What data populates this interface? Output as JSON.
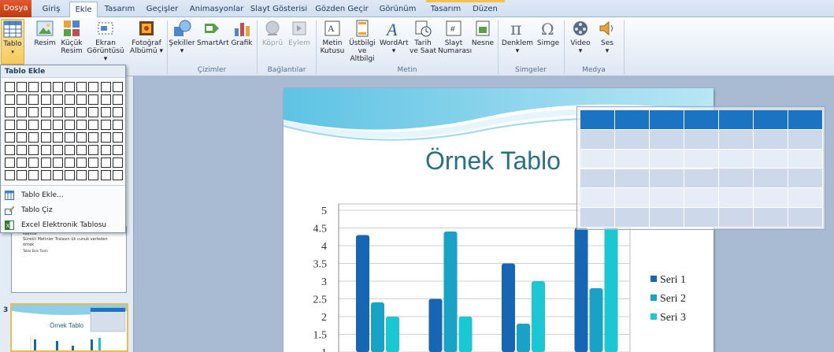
{
  "tabs": [
    {
      "label": "Dosya"
    },
    {
      "label": "Giriş"
    },
    {
      "label": "Ekle"
    },
    {
      "label": "Tasarım"
    },
    {
      "label": "Geçişler"
    },
    {
      "label": "Animasyonlar"
    },
    {
      "label": "Slayt Gösterisi"
    },
    {
      "label": "Gözden Geçir"
    },
    {
      "label": "Görünüm"
    },
    {
      "label": "Tasarım"
    },
    {
      "label": "Düzen"
    }
  ],
  "ribbon": {
    "buttons": [
      {
        "l1": "Tablo",
        "l2": ""
      },
      {
        "l1": "Resim",
        "l2": ""
      },
      {
        "l1": "Küçük",
        "l2": "Resim"
      },
      {
        "l1": "Ekran",
        "l2": "Görüntüsü ▾"
      },
      {
        "l1": "Fotoğraf",
        "l2": "Albümü ▾"
      },
      {
        "l1": "Şekiller",
        "l2": "▾"
      },
      {
        "l1": "SmartArt",
        "l2": ""
      },
      {
        "l1": "Grafik",
        "l2": ""
      },
      {
        "l1": "Köprü",
        "l2": ""
      },
      {
        "l1": "Eylem",
        "l2": ""
      },
      {
        "l1": "Metin",
        "l2": "Kutusu"
      },
      {
        "l1": "Üstbilgi",
        "l2": "ve Altbilgi"
      },
      {
        "l1": "WordArt",
        "l2": "▾"
      },
      {
        "l1": "Tarih",
        "l2": "ve Saat"
      },
      {
        "l1": "Slayt",
        "l2": "Numarası"
      },
      {
        "l1": "Nesne",
        "l2": ""
      },
      {
        "l1": "Denklem",
        "l2": "▾"
      },
      {
        "l1": "Simge",
        "l2": ""
      },
      {
        "l1": "Video",
        "l2": "▾"
      },
      {
        "l1": "Ses",
        "l2": "▾"
      }
    ],
    "groups": {
      "cizimler": "Çizimler",
      "baglantilar": "Bağlantılar",
      "metin": "Metin",
      "simgeler": "Simgeler",
      "medya": "Medya"
    }
  },
  "dropdown": {
    "title": "Tablo Ekle",
    "items": [
      {
        "label": "Tablo Ekle..."
      },
      {
        "label": "Tablo Çiz"
      },
      {
        "label": "Excel Elektronik Tablosu"
      }
    ]
  },
  "thumbnails": {
    "slide2_lines": [
      "kayıtta",
      "Sürekli Metinler Tralasın ük cunuk verleden",
      "örnek"
    ],
    "slide2_small": [
      "Tablo Ekle Tanıtı",
      "..."
    ],
    "slide3_number": "3",
    "slide3_title": "Örnek Tablo"
  },
  "slide": {
    "title": "Örnek Tablo"
  },
  "colors": {
    "accent": "#f7c95c",
    "file_tab": "#c03a10",
    "series1": "#1766b4",
    "series2": "#1aa2c6",
    "series3": "#1cc7d4",
    "table_header": "#1b73c4"
  },
  "chart_data": {
    "type": "bar",
    "categories": [
      "",
      "",
      "",
      ""
    ],
    "series": [
      {
        "name": "Seri 1",
        "values": [
          4.3,
          2.5,
          3.5,
          4.5
        ]
      },
      {
        "name": "Seri 2",
        "values": [
          2.4,
          4.4,
          1.8,
          2.8
        ]
      },
      {
        "name": "Seri 3",
        "values": [
          2.0,
          2.0,
          3.0,
          5.0
        ]
      }
    ],
    "yticks": [
      "5",
      "4.5",
      "4",
      "3.5",
      "3",
      "2.5",
      "2",
      "1.5",
      "1"
    ],
    "ylim": [
      1,
      5
    ],
    "legend": "right",
    "grid": true
  }
}
